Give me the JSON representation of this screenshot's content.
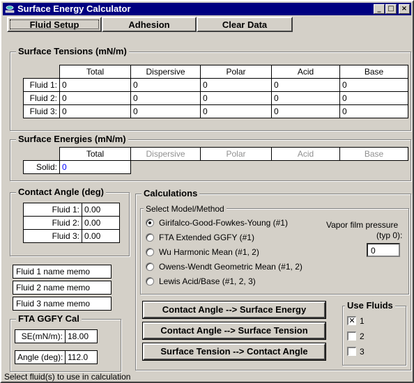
{
  "window": {
    "title": "Surface Energy Calculator",
    "minimize": "_",
    "maximize": "□",
    "close": "×"
  },
  "tabs": [
    "Fluid Setup",
    "Adhesion",
    "Clear Data"
  ],
  "surface_tensions": {
    "title": "Surface Tensions (mN/m)",
    "columns": [
      "Total",
      "Dispersive",
      "Polar",
      "Acid",
      "Base"
    ],
    "rows": [
      {
        "label": "Fluid 1:",
        "values": [
          "0",
          "0",
          "0",
          "0",
          "0"
        ]
      },
      {
        "label": "Fluid 2:",
        "values": [
          "0",
          "0",
          "0",
          "0",
          "0"
        ]
      },
      {
        "label": "Fluid 3:",
        "values": [
          "0",
          "0",
          "0",
          "0",
          "0"
        ]
      }
    ]
  },
  "surface_energies": {
    "title": "Surface Energies (mN/m)",
    "columns": [
      "Total",
      "Dispersive",
      "Polar",
      "Acid",
      "Base"
    ],
    "row_label": "Solid:",
    "total": "0"
  },
  "contact_angle": {
    "title": "Contact Angle (deg)",
    "rows": [
      {
        "label": "Fluid 1:",
        "value": "0.00"
      },
      {
        "label": "Fluid 2:",
        "value": "0.00"
      },
      {
        "label": "Fluid 3:",
        "value": "0.00"
      }
    ]
  },
  "memos": [
    "Fluid 1 name memo",
    "Fluid 2 name memo",
    "Fluid 3 name memo"
  ],
  "fta_cal": {
    "title": "FTA GGFY Cal",
    "se_label": "SE(mN/m):",
    "se_value": "18.00",
    "angle_label": "Angle (deg):",
    "angle_value": "112.0"
  },
  "calculations": {
    "title": "Calculations",
    "model_title": "Select Model/Method",
    "models": [
      {
        "label": "Girifalco-Good-Fowkes-Young (#1)",
        "checked": true
      },
      {
        "label": "FTA Extended GGFY (#1)",
        "checked": false
      },
      {
        "label": "Wu Harmonic Mean (#1, 2)",
        "checked": false
      },
      {
        "label": "Owens-Wendt Geometric Mean (#1, 2)",
        "checked": false
      },
      {
        "label": "Lewis Acid/Base (#1, 2, 3)",
        "checked": false
      }
    ],
    "vapor_label_1": "Vapor film pressure",
    "vapor_label_2": "(typ 0):",
    "vapor_value": "0",
    "buttons": [
      "Contact Angle --> Surface Energy",
      "Contact Angle --> Surface Tension",
      "Surface Tension --> Contact Angle"
    ],
    "use_fluids_title": "Use Fluids",
    "use_fluids": [
      {
        "label": "1",
        "checked": true
      },
      {
        "label": "2",
        "checked": false
      },
      {
        "label": "3",
        "checked": false
      }
    ]
  },
  "status": "Select fluid(s) to use in calculation"
}
